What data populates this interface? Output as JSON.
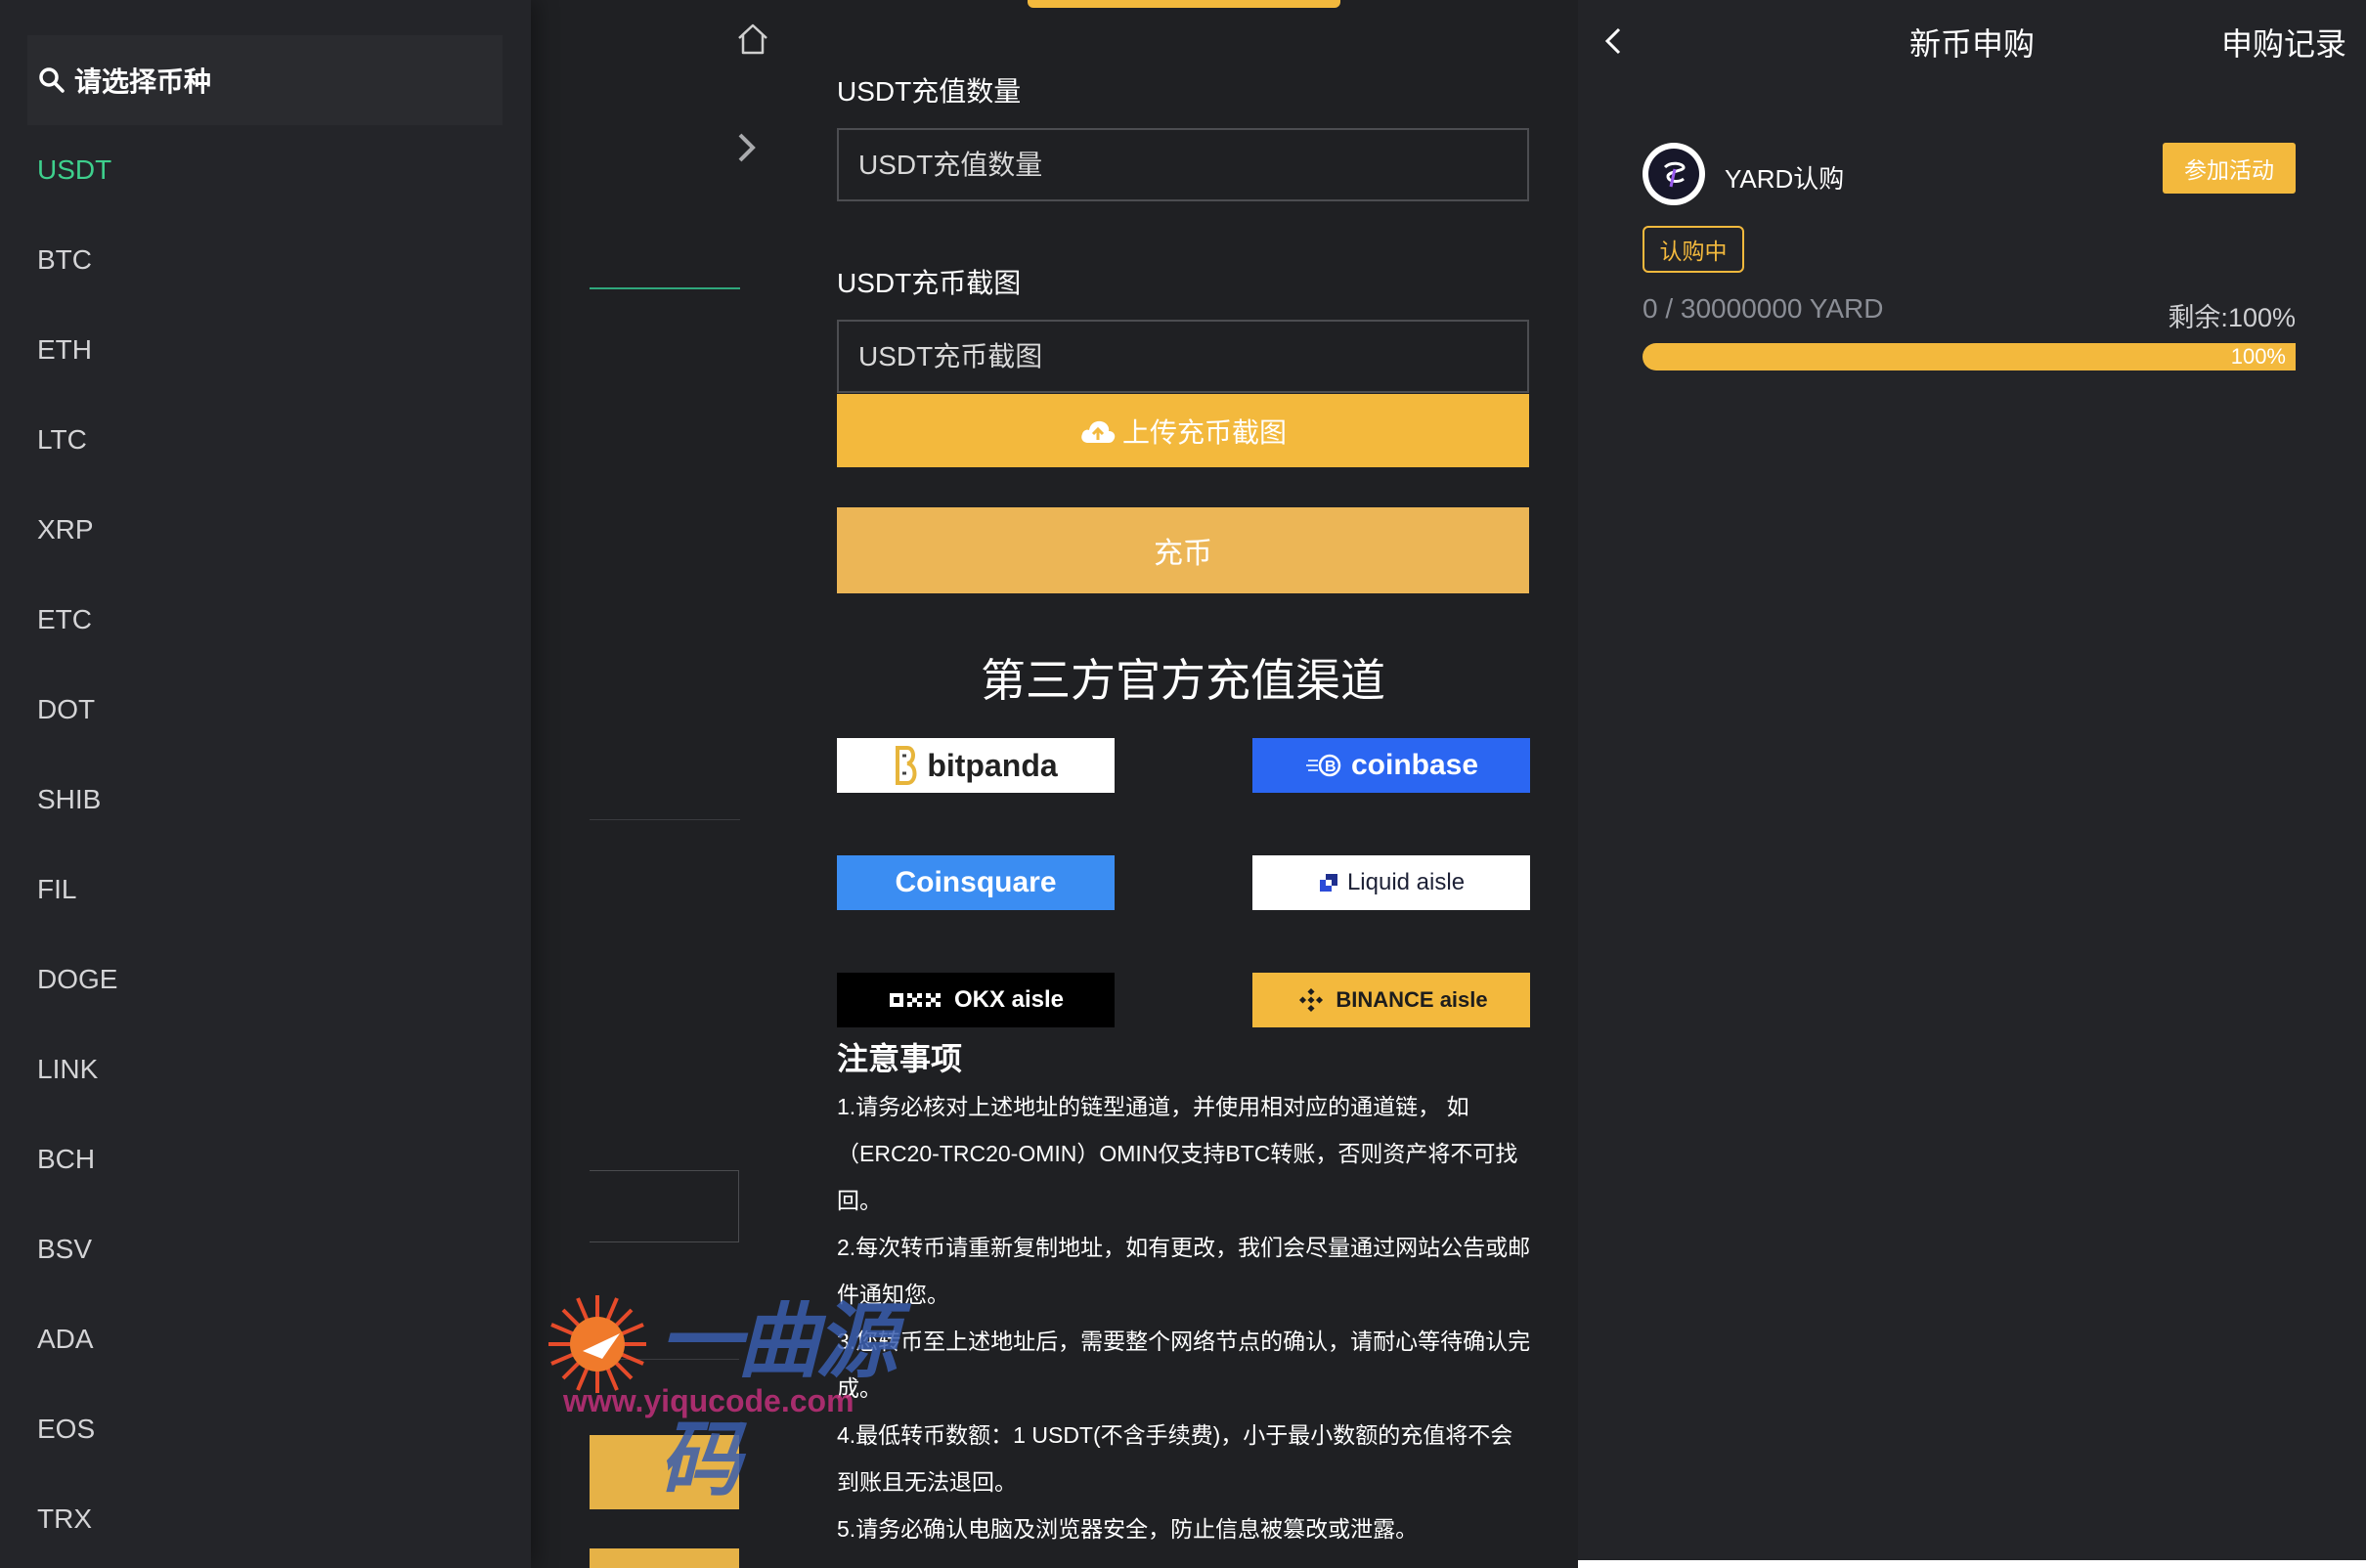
{
  "drawer": {
    "search_placeholder": "请选择币种",
    "coins": [
      "USDT",
      "BTC",
      "ETH",
      "LTC",
      "XRP",
      "ETC",
      "DOT",
      "SHIB",
      "FIL",
      "DOGE",
      "LINK",
      "BCH",
      "BSV",
      "ADA",
      "EOS",
      "TRX"
    ],
    "active_coin": "USDT"
  },
  "deposit": {
    "amount_label": "USDT充值数量",
    "amount_placeholder": "USDT充值数量",
    "screenshot_label": "USDT充币截图",
    "screenshot_placeholder": "USDT充币截图",
    "upload_label": "上传充币截图",
    "submit_label": "充币",
    "channels_title": "第三方官方充值渠道",
    "partners": {
      "bitpanda": "bitpanda",
      "coinbase": "coinbase",
      "coinsquare": "Coinsquare",
      "liquid": "Liquid aisle",
      "okx": "OKX aisle",
      "binance": "BINANCE aisle"
    },
    "notes_title": "注意事项",
    "notes": [
      "1.请务必核对上述地址的链型通道，并使用相对应的通道链， 如（ERC20-TRC20-OMIN）OMIN仅支持BTC转账，否则资产将不可找回。",
      "2.每次转币请重新复制地址，如有更改，我们会尽量通过网站公告或邮件通知您。",
      "3.您转币至上述地址后，需要整个网络节点的确认，请耐心等待确认完成。",
      "4.最低转币数额：1 USDT(不含手续费)，小于最小数额的充值将不会到账且无法退回。",
      "5.请务必确认电脑及浏览器安全，防止信息被篡改或泄露。"
    ]
  },
  "watermark": {
    "text": "一曲源码",
    "url": "www.yiqucode.com"
  },
  "subscription": {
    "title": "新币申购",
    "records_label": "申购记录",
    "project_name": "YARD认购",
    "join_label": "参加活动",
    "status": "认购中",
    "amount": "0 / 30000000 YARD",
    "remaining": "剩余:100%",
    "progress_fraction": 1.0,
    "progress_label": "100%",
    "colors": {
      "accent": "#f3b93d",
      "active_green": "#3ed08d"
    }
  }
}
